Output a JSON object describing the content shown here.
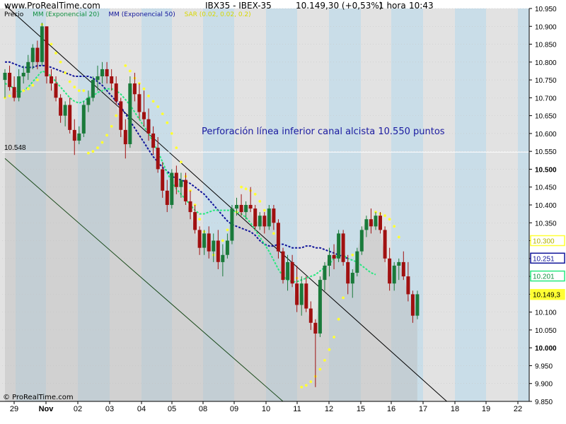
{
  "header": {
    "site": "www.ProRealTime.com",
    "instrument": "IBX35 - IBEX-35",
    "quote": "10.149,30 (+0,53%)",
    "timeframe": "1 hora",
    "time": "10:43"
  },
  "legend": {
    "price": "Precio",
    "ema20": "MM (Exponencial 20)",
    "ema50": "MM (Exponencial 50)",
    "sar": "SAR (0.02, 0.02, 0.2)"
  },
  "annotation": "Perforación línea inferior canal alcista 10.550 puntos",
  "copyright": "© ProRealTime.com",
  "colors": {
    "up": "#1a7a3a",
    "down": "#a01010",
    "ema20": "#27e87f",
    "ema50": "#10149a",
    "sar": "#ffff33",
    "bandA": "#e2e2e2",
    "bandB": "#c9dde8",
    "annotation": "#1a1aa0"
  },
  "chart_data": {
    "type": "candlestick",
    "title": "IBX35 - IBEX-35 10.149,30 (+0,53%) 1 hora 10:43",
    "ylim": [
      9850,
      10950
    ],
    "y_ticks": [
      {
        "value": 10950,
        "label": "10.950"
      },
      {
        "value": 10900,
        "label": "10.900"
      },
      {
        "value": 10850,
        "label": "10.850"
      },
      {
        "value": 10800,
        "label": "10.800"
      },
      {
        "value": 10750,
        "label": "10.750"
      },
      {
        "value": 10700,
        "label": "10.700"
      },
      {
        "value": 10650,
        "label": "10.650"
      },
      {
        "value": 10600,
        "label": "10.600"
      },
      {
        "value": 10550,
        "label": "10.550"
      },
      {
        "value": 10500,
        "label": "10.500"
      },
      {
        "value": 10450,
        "label": "10.450"
      },
      {
        "value": 10400,
        "label": "10.400"
      },
      {
        "value": 10350,
        "label": "10.350"
      },
      {
        "value": 10300,
        "label": "10.300"
      },
      {
        "value": 10250,
        "label": "10.250"
      },
      {
        "value": 10200,
        "label": "10.200"
      },
      {
        "value": 10150,
        "label": "10.150"
      },
      {
        "value": 10100,
        "label": "10.100"
      },
      {
        "value": 10050,
        "label": "10.050"
      },
      {
        "value": 10000,
        "label": "10.000"
      },
      {
        "value": 9950,
        "label": "9.950"
      },
      {
        "value": 9900,
        "label": "9.900"
      },
      {
        "value": 9850,
        "label": "9.850"
      }
    ],
    "x_labels": [
      "29",
      "Nov",
      "02",
      "03",
      "04",
      "05",
      "08",
      "09",
      "10",
      "11",
      "12",
      "15",
      "16",
      "17",
      "18",
      "19",
      "22"
    ],
    "level_line": {
      "value": 10548,
      "label": "10.548"
    },
    "price_tags": [
      {
        "value": 10300,
        "label": "10.300",
        "color": "#ffff33",
        "text_color": "#b0b000"
      },
      {
        "value": 10251,
        "label": "10.251",
        "color": "#10149a",
        "text_color": "#10149a"
      },
      {
        "value": 10201,
        "label": "10.201",
        "color": "#27e87f",
        "text_color": "#109040"
      },
      {
        "value": 10149.3,
        "label": "10.149,3",
        "color": "#ffff33",
        "text_color": "#000000"
      }
    ],
    "trendlines": [
      {
        "name": "upper channel",
        "start": [
          0,
          10960
        ],
        "end": [
          70,
          10145
        ]
      },
      {
        "name": "lower channel",
        "start": [
          0,
          10530
        ],
        "end": [
          60,
          9850
        ]
      }
    ],
    "candles": [
      {
        "o": 10750,
        "h": 10780,
        "l": 10700,
        "c": 10770
      },
      {
        "o": 10770,
        "h": 10790,
        "l": 10720,
        "c": 10730
      },
      {
        "o": 10730,
        "h": 10760,
        "l": 10690,
        "c": 10700
      },
      {
        "o": 10700,
        "h": 10780,
        "l": 10690,
        "c": 10760
      },
      {
        "o": 10760,
        "h": 10790,
        "l": 10740,
        "c": 10770
      },
      {
        "o": 10770,
        "h": 10820,
        "l": 10750,
        "c": 10800
      },
      {
        "o": 10800,
        "h": 10850,
        "l": 10780,
        "c": 10840
      },
      {
        "o": 10840,
        "h": 10860,
        "l": 10780,
        "c": 10800
      },
      {
        "o": 10800,
        "h": 10910,
        "l": 10790,
        "c": 10900
      },
      {
        "o": 10900,
        "h": 10900,
        "l": 10740,
        "c": 10760
      },
      {
        "o": 10760,
        "h": 10780,
        "l": 10720,
        "c": 10740
      },
      {
        "o": 10740,
        "h": 10760,
        "l": 10690,
        "c": 10700
      },
      {
        "o": 10700,
        "h": 10710,
        "l": 10630,
        "c": 10650
      },
      {
        "o": 10650,
        "h": 10690,
        "l": 10620,
        "c": 10680
      },
      {
        "o": 10680,
        "h": 10700,
        "l": 10600,
        "c": 10610
      },
      {
        "o": 10610,
        "h": 10640,
        "l": 10540,
        "c": 10580
      },
      {
        "o": 10580,
        "h": 10620,
        "l": 10570,
        "c": 10600
      },
      {
        "o": 10600,
        "h": 10690,
        "l": 10590,
        "c": 10680
      },
      {
        "o": 10680,
        "h": 10720,
        "l": 10660,
        "c": 10700
      },
      {
        "o": 10700,
        "h": 10760,
        "l": 10690,
        "c": 10750
      },
      {
        "o": 10750,
        "h": 10790,
        "l": 10720,
        "c": 10760
      },
      {
        "o": 10760,
        "h": 10800,
        "l": 10740,
        "c": 10780
      },
      {
        "o": 10780,
        "h": 10800,
        "l": 10740,
        "c": 10760
      },
      {
        "o": 10760,
        "h": 10780,
        "l": 10720,
        "c": 10740
      },
      {
        "o": 10740,
        "h": 10760,
        "l": 10680,
        "c": 10690
      },
      {
        "o": 10690,
        "h": 10700,
        "l": 10590,
        "c": 10610
      },
      {
        "o": 10610,
        "h": 10640,
        "l": 10530,
        "c": 10570
      },
      {
        "o": 10570,
        "h": 10760,
        "l": 10560,
        "c": 10740
      },
      {
        "o": 10740,
        "h": 10770,
        "l": 10690,
        "c": 10710
      },
      {
        "o": 10710,
        "h": 10740,
        "l": 10640,
        "c": 10660
      },
      {
        "o": 10660,
        "h": 10720,
        "l": 10620,
        "c": 10640
      },
      {
        "o": 10640,
        "h": 10670,
        "l": 10580,
        "c": 10600
      },
      {
        "o": 10600,
        "h": 10620,
        "l": 10540,
        "c": 10560
      },
      {
        "o": 10560,
        "h": 10590,
        "l": 10490,
        "c": 10500
      },
      {
        "o": 10500,
        "h": 10520,
        "l": 10420,
        "c": 10440
      },
      {
        "o": 10440,
        "h": 10470,
        "l": 10380,
        "c": 10400
      },
      {
        "o": 10400,
        "h": 10500,
        "l": 10390,
        "c": 10490
      },
      {
        "o": 10490,
        "h": 10510,
        "l": 10430,
        "c": 10450
      },
      {
        "o": 10450,
        "h": 10490,
        "l": 10420,
        "c": 10470
      },
      {
        "o": 10470,
        "h": 10490,
        "l": 10400,
        "c": 10410
      },
      {
        "o": 10410,
        "h": 10440,
        "l": 10360,
        "c": 10380
      },
      {
        "o": 10380,
        "h": 10400,
        "l": 10320,
        "c": 10330
      },
      {
        "o": 10330,
        "h": 10340,
        "l": 10260,
        "c": 10280
      },
      {
        "o": 10280,
        "h": 10330,
        "l": 10260,
        "c": 10320
      },
      {
        "o": 10320,
        "h": 10340,
        "l": 10250,
        "c": 10270
      },
      {
        "o": 10270,
        "h": 10320,
        "l": 10240,
        "c": 10300
      },
      {
        "o": 10300,
        "h": 10330,
        "l": 10220,
        "c": 10240
      },
      {
        "o": 10240,
        "h": 10290,
        "l": 10200,
        "c": 10260
      },
      {
        "o": 10260,
        "h": 10320,
        "l": 10250,
        "c": 10300
      },
      {
        "o": 10300,
        "h": 10400,
        "l": 10290,
        "c": 10390
      },
      {
        "o": 10390,
        "h": 10420,
        "l": 10370,
        "c": 10400
      },
      {
        "o": 10400,
        "h": 10430,
        "l": 10370,
        "c": 10380
      },
      {
        "o": 10380,
        "h": 10410,
        "l": 10360,
        "c": 10400
      },
      {
        "o": 10400,
        "h": 10450,
        "l": 10380,
        "c": 10390
      },
      {
        "o": 10390,
        "h": 10400,
        "l": 10330,
        "c": 10340
      },
      {
        "o": 10340,
        "h": 10380,
        "l": 10330,
        "c": 10370
      },
      {
        "o": 10370,
        "h": 10380,
        "l": 10320,
        "c": 10340
      },
      {
        "o": 10340,
        "h": 10400,
        "l": 10330,
        "c": 10390
      },
      {
        "o": 10390,
        "h": 10400,
        "l": 10330,
        "c": 10350
      },
      {
        "o": 10350,
        "h": 10360,
        "l": 10250,
        "c": 10270
      },
      {
        "o": 10270,
        "h": 10280,
        "l": 10180,
        "c": 10190
      },
      {
        "o": 10190,
        "h": 10260,
        "l": 10160,
        "c": 10240
      },
      {
        "o": 10240,
        "h": 10260,
        "l": 10170,
        "c": 10180
      },
      {
        "o": 10180,
        "h": 10230,
        "l": 10100,
        "c": 10120
      },
      {
        "o": 10120,
        "h": 10200,
        "l": 10090,
        "c": 10180
      },
      {
        "o": 10180,
        "h": 10200,
        "l": 10100,
        "c": 10110
      },
      {
        "o": 10110,
        "h": 10130,
        "l": 10050,
        "c": 10070
      },
      {
        "o": 10070,
        "h": 10080,
        "l": 9890,
        "c": 10040
      },
      {
        "o": 10040,
        "h": 10200,
        "l": 10030,
        "c": 10190
      },
      {
        "o": 10190,
        "h": 10240,
        "l": 10160,
        "c": 10230
      },
      {
        "o": 10230,
        "h": 10280,
        "l": 10200,
        "c": 10260
      },
      {
        "o": 10260,
        "h": 10290,
        "l": 10220,
        "c": 10250
      },
      {
        "o": 10250,
        "h": 10330,
        "l": 10240,
        "c": 10320
      },
      {
        "o": 10320,
        "h": 10330,
        "l": 10230,
        "c": 10240
      },
      {
        "o": 10240,
        "h": 10260,
        "l": 10150,
        "c": 10180
      },
      {
        "o": 10180,
        "h": 10220,
        "l": 10140,
        "c": 10210
      },
      {
        "o": 10210,
        "h": 10280,
        "l": 10200,
        "c": 10270
      },
      {
        "o": 10270,
        "h": 10340,
        "l": 10260,
        "c": 10330
      },
      {
        "o": 10330,
        "h": 10370,
        "l": 10310,
        "c": 10360
      },
      {
        "o": 10360,
        "h": 10390,
        "l": 10320,
        "c": 10340
      },
      {
        "o": 10340,
        "h": 10380,
        "l": 10330,
        "c": 10370
      },
      {
        "o": 10370,
        "h": 10380,
        "l": 10320,
        "c": 10330
      },
      {
        "o": 10330,
        "h": 10340,
        "l": 10240,
        "c": 10250
      },
      {
        "o": 10250,
        "h": 10280,
        "l": 10160,
        "c": 10180
      },
      {
        "o": 10180,
        "h": 10240,
        "l": 10160,
        "c": 10230
      },
      {
        "o": 10230,
        "h": 10250,
        "l": 10190,
        "c": 10240
      },
      {
        "o": 10240,
        "h": 10270,
        "l": 10190,
        "c": 10200
      },
      {
        "o": 10200,
        "h": 10240,
        "l": 10130,
        "c": 10150
      },
      {
        "o": 10150,
        "h": 10160,
        "l": 10070,
        "c": 10090
      },
      {
        "o": 10090,
        "h": 10160,
        "l": 10080,
        "c": 10150
      }
    ],
    "ema20": [
      10740,
      10735,
      10725,
      10715,
      10720,
      10730,
      10745,
      10760,
      10775,
      10770,
      10760,
      10745,
      10730,
      10715,
      10700,
      10690,
      10685,
      10690,
      10700,
      10705,
      10715,
      10720,
      10725,
      10725,
      10720,
      10710,
      10695,
      10680,
      10660,
      10640,
      10620,
      10600,
      10575,
      10550,
      10520,
      10490,
      10465,
      10445,
      10430,
      10415,
      10400,
      10385,
      10375,
      10375,
      10380,
      10385,
      10385,
      10385,
      10385,
      10385,
      10380,
      10375,
      10365,
      10350,
      10330,
      10310,
      10290,
      10270,
      10245,
      10220,
      10200,
      10190,
      10185,
      10185,
      10190,
      10195,
      10200,
      10205,
      10215,
      10225,
      10235,
      10250,
      10260,
      10260,
      10250,
      10245,
      10240,
      10230,
      10220,
      10210,
      10205
    ],
    "ema50": [
      10800,
      10800,
      10795,
      10790,
      10785,
      10785,
      10785,
      10790,
      10790,
      10790,
      10785,
      10780,
      10775,
      10770,
      10765,
      10760,
      10760,
      10760,
      10760,
      10755,
      10745,
      10735,
      10720,
      10705,
      10690,
      10675,
      10655,
      10635,
      10615,
      10595,
      10575,
      10555,
      10535,
      10520,
      10505,
      10495,
      10480,
      10475,
      10470,
      10465,
      10460,
      10450,
      10440,
      10430,
      10415,
      10400,
      10385,
      10370,
      10355,
      10345,
      10340,
      10335,
      10330,
      10325,
      10315,
      10300,
      10290,
      10285,
      10285,
      10290,
      10290,
      10285,
      10280,
      10280,
      10280,
      10285,
      10285,
      10280,
      10280,
      10275,
      10270,
      10265,
      10260,
      10255,
      10250
    ],
    "sar": [
      [
        0,
        10700
      ],
      [
        1,
        10705
      ],
      [
        2,
        10710
      ],
      [
        3,
        10715
      ],
      [
        4,
        10720
      ],
      [
        5,
        10725
      ],
      [
        6,
        10735
      ],
      [
        7,
        10750
      ],
      [
        8,
        10905
      ],
      [
        9,
        10880
      ],
      [
        10,
        10850
      ],
      [
        11,
        10825
      ],
      [
        12,
        10800
      ],
      [
        13,
        10770
      ],
      [
        14,
        10745
      ],
      [
        15,
        10730
      ],
      [
        16,
        10720
      ],
      [
        17,
        10720
      ],
      [
        18,
        10545
      ],
      [
        19,
        10550
      ],
      [
        20,
        10560
      ],
      [
        21,
        10575
      ],
      [
        22,
        10595
      ],
      [
        23,
        10620
      ],
      [
        24,
        10650
      ],
      [
        25,
        10680
      ],
      [
        26,
        10790
      ],
      [
        27,
        10775
      ],
      [
        28,
        10755
      ],
      [
        29,
        10740
      ],
      [
        30,
        10725
      ],
      [
        31,
        10705
      ],
      [
        32,
        10690
      ],
      [
        33,
        10675
      ],
      [
        34,
        10655
      ],
      [
        35,
        10630
      ],
      [
        36,
        10600
      ],
      [
        37,
        10560
      ],
      [
        38,
        10520
      ],
      [
        39,
        10480
      ],
      [
        40,
        10440
      ],
      [
        41,
        10400
      ],
      [
        42,
        10360
      ],
      [
        43,
        10325
      ],
      [
        44,
        10290
      ],
      [
        45,
        10260
      ],
      [
        46,
        10270
      ],
      [
        47,
        10300
      ],
      [
        48,
        10330
      ],
      [
        49,
        10360
      ],
      [
        50,
        10380
      ],
      [
        51,
        10450
      ],
      [
        52,
        10445
      ],
      [
        53,
        10440
      ],
      [
        54,
        10430
      ],
      [
        55,
        10410
      ],
      [
        56,
        10385
      ],
      [
        57,
        10355
      ],
      [
        58,
        10320
      ],
      [
        59,
        10285
      ],
      [
        60,
        10250
      ],
      [
        61,
        10220
      ],
      [
        62,
        10200
      ],
      [
        63,
        10195
      ],
      [
        64,
        9890
      ],
      [
        65,
        9895
      ],
      [
        66,
        9905
      ],
      [
        67,
        9920
      ],
      [
        68,
        9940
      ],
      [
        69,
        9965
      ],
      [
        70,
        9995
      ],
      [
        71,
        10030
      ],
      [
        72,
        10080
      ],
      [
        73,
        10140
      ],
      [
        74,
        10200
      ],
      [
        75,
        10260
      ],
      [
        80,
        10380
      ],
      [
        81,
        10375
      ],
      [
        82,
        10370
      ],
      [
        83,
        10360
      ],
      [
        84,
        10340
      ],
      [
        85,
        10310
      ]
    ]
  }
}
